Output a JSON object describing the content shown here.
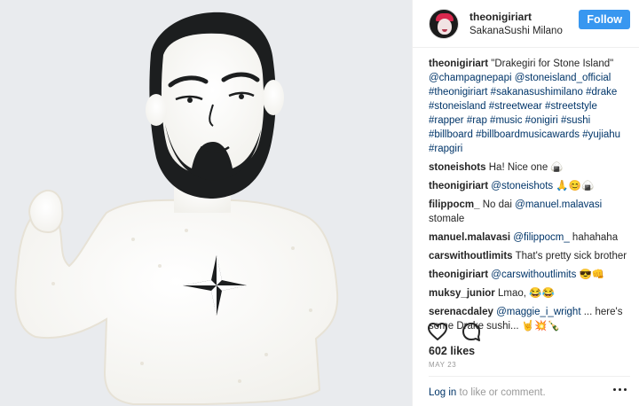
{
  "header": {
    "username": "theonigiriart",
    "location": "SakanaSushi Milano",
    "follow_label": "Follow"
  },
  "caption": {
    "username": "theonigiriart",
    "text": "\"Drakegiri for Stone Island\"",
    "tags": "@champagnepapi @stoneisland_official #theonigiriart #sakanasushimilano #drake #stoneisland #streetwear #streetstyle #rapper #rap #music #onigiri #sushi #billboard #billboardmusicawards #yujiahu #rapgiri"
  },
  "comments": [
    {
      "user": "stoneishots",
      "mention": "",
      "text": "Ha! Nice one 🍙"
    },
    {
      "user": "theonigiriart",
      "mention": "@stoneishots",
      "text": "🙏😊🍙"
    },
    {
      "user": "filippocm_",
      "mention": "",
      "text": "No dai",
      "mention2": "@manuel.malavasi",
      "text2": "stomale"
    },
    {
      "user": "manuel.malavasi",
      "mention": "@filippocm_",
      "text": "hahahaha"
    },
    {
      "user": "carswithoutlimits",
      "mention": "",
      "text": "That's pretty sick brother"
    },
    {
      "user": "theonigiriart",
      "mention": "@carswithoutlimits",
      "text": "😎👊"
    },
    {
      "user": "muksy_junior",
      "mention": "",
      "text": "Lmao, 😂😂"
    },
    {
      "user": "serenacdaley",
      "mention": "@maggie_i_wright",
      "text": "... here's some Drake sushi... 🤘💥🍾"
    }
  ],
  "likes": "602 likes",
  "date": "MAY 23",
  "login": {
    "link": "Log in",
    "text": "to like or comment."
  },
  "colors": {
    "follow_bg": "#3897f0",
    "link": "#003569",
    "text": "#262626",
    "muted": "#999999"
  },
  "icons": [
    "heart-icon",
    "comment-icon",
    "more-options-icon"
  ]
}
